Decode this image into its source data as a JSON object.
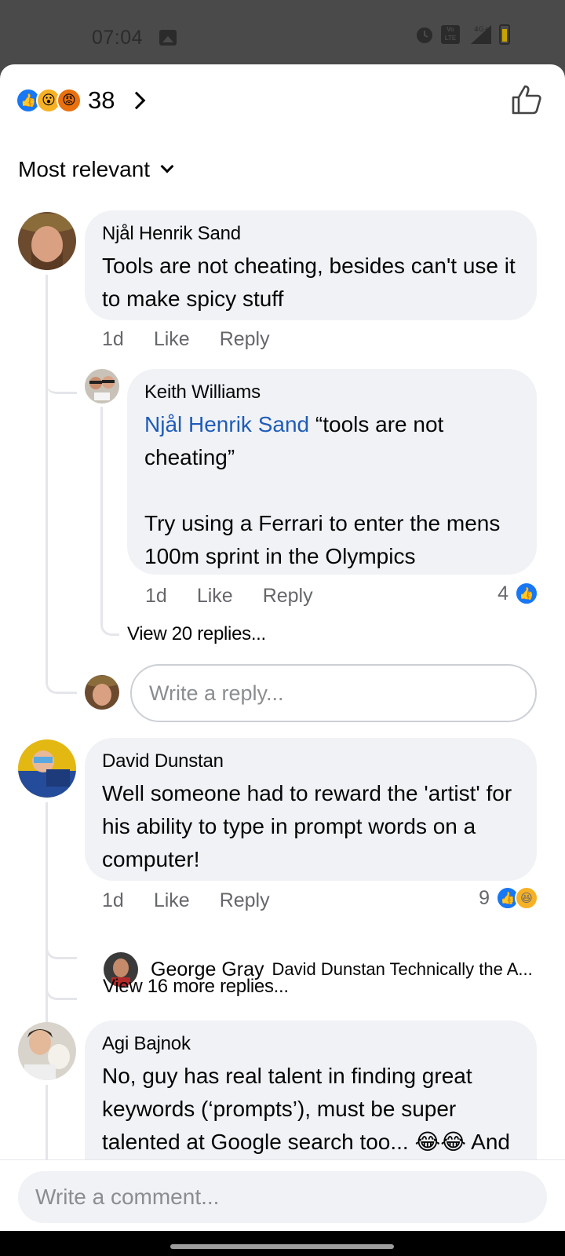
{
  "status_bar": {
    "time": "07:04",
    "network": "4G+",
    "volte": "Vo LTE"
  },
  "reactions": {
    "types": [
      "like",
      "wow",
      "angry"
    ],
    "count": "38"
  },
  "sort": {
    "label": "Most relevant"
  },
  "comments": [
    {
      "author": "Njål Henrik Sand",
      "text": "Tools are not cheating, besides can't use it to make spicy stuff",
      "time": "1d",
      "like_label": "Like",
      "reply_label": "Reply",
      "replies": [
        {
          "author": "Keith Williams",
          "mention": "Njål Henrik Sand",
          "text_line1": " “tools are not cheating”",
          "text_line2": "Try using a Ferrari to enter the mens 100m sprint in the Olympics",
          "time": "1d",
          "like_label": "Like",
          "reply_label": "Reply",
          "reaction_count": "4"
        }
      ],
      "view_replies": "View 20 replies...",
      "reply_placeholder": "Write a reply..."
    },
    {
      "author": "David Dunstan",
      "text": "Well someone had to reward the 'artist' for his ability to type in prompt words on a computer!",
      "time": "1d",
      "like_label": "Like",
      "reply_label": "Reply",
      "reaction_count": "9",
      "preview_reply": {
        "author": "George Gray",
        "text": "David Dunstan Technically the A..."
      },
      "view_more": "View 16 more replies..."
    },
    {
      "author": "Agi Bajnok",
      "text": "No, guy has real talent in finding great keywords (‘prompts’), must be super talented at Google search too... 😂😂 And"
    }
  ],
  "composer": {
    "placeholder": "Write a comment..."
  }
}
